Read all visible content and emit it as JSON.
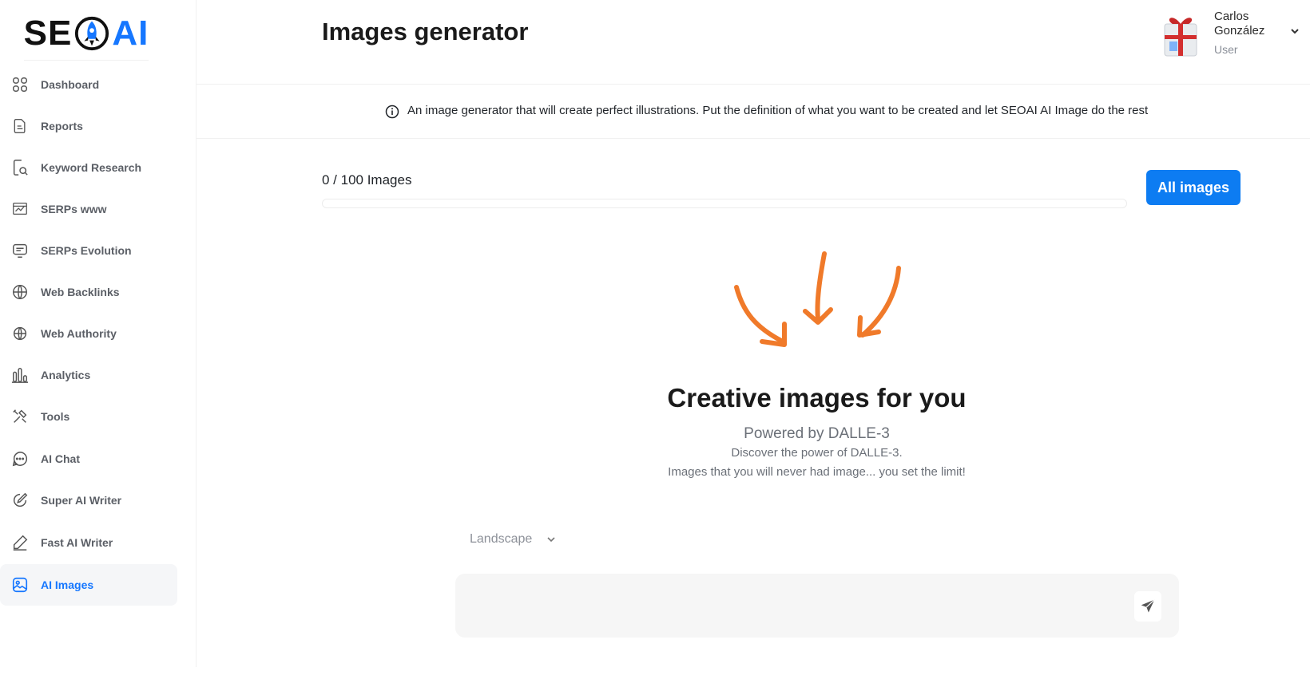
{
  "app": {
    "logo": "SEOAI",
    "brand_color": "#1677ff"
  },
  "sidebar": {
    "items": [
      {
        "label": "Dashboard",
        "icon": "grid-icon"
      },
      {
        "label": "Reports",
        "icon": "document-icon"
      },
      {
        "label": "Keyword Research",
        "icon": "search-document-icon"
      },
      {
        "label": "SERPs www",
        "icon": "serps-icon"
      },
      {
        "label": "SERPs Evolution",
        "icon": "monitor-icon"
      },
      {
        "label": "Web Backlinks",
        "icon": "globe-icon"
      },
      {
        "label": "Web Authority",
        "icon": "globe-lock-icon"
      },
      {
        "label": "Analytics",
        "icon": "bar-chart-icon"
      },
      {
        "label": "Tools",
        "icon": "tools-icon"
      },
      {
        "label": "AI Chat",
        "icon": "chat-bubble-icon"
      },
      {
        "label": "Super AI Writer",
        "icon": "pen-circle-icon"
      },
      {
        "label": "Fast AI Writer",
        "icon": "pencil-icon"
      },
      {
        "label": "AI Images",
        "icon": "image-icon",
        "active": true
      }
    ]
  },
  "header": {
    "title": "Images generator",
    "user": {
      "name": "Carlos González",
      "role": "User"
    }
  },
  "info": {
    "text": "An image generator that will create perfect illustrations. Put the definition of what you want to be created and let SEOAI AI Image do the rest"
  },
  "counter": {
    "text": "0 / 100 Images",
    "used": 0,
    "limit": 100,
    "progress_percent": 0
  },
  "buttons": {
    "all_images": "All images"
  },
  "hero": {
    "title": "Creative images for you",
    "subtitle": "Powered by DALLE-3",
    "line1": "Discover the power of DALLE-3.",
    "line2": "Images that you will never had image... you set the limit!",
    "arrow_color": "#f07a2a"
  },
  "options": {
    "orientation": "Landscape"
  },
  "prompt": {
    "placeholder": "",
    "value": ""
  }
}
